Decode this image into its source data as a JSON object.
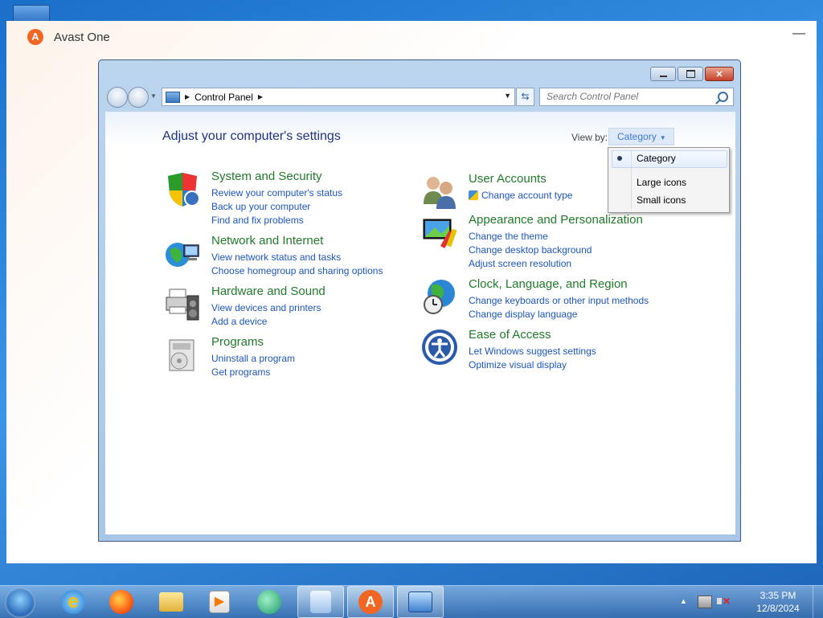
{
  "avast": {
    "title": "Avast One",
    "logo": "avast-logo-icon",
    "minimize": "—"
  },
  "window": {
    "address": {
      "crumb": "Control Panel"
    },
    "search": {
      "placeholder": "Search Control Panel"
    },
    "heading": "Adjust your computer's settings",
    "view_by": {
      "label": "View by:",
      "value": "Category"
    },
    "categories": [
      {
        "title": "System and Security",
        "icon": "shield-icon",
        "links": [
          "Review your computer's status",
          "Back up your computer",
          "Find and fix problems"
        ]
      },
      {
        "title": "Network and Internet",
        "icon": "network-globe-icon",
        "links": [
          "View network status and tasks",
          "Choose homegroup and sharing options"
        ]
      },
      {
        "title": "Hardware and Sound",
        "icon": "printer-speaker-icon",
        "links": [
          "View devices and printers",
          "Add a device"
        ]
      },
      {
        "title": "Programs",
        "icon": "programs-icon",
        "links": [
          "Uninstall a program",
          "Get programs"
        ]
      },
      {
        "title": "User Accounts",
        "icon": "users-icon",
        "links": [
          "Change account type"
        ]
      },
      {
        "title": "Appearance and Personalization",
        "icon": "monitor-paint-icon",
        "links": [
          "Change the theme",
          "Change desktop background",
          "Adjust screen resolution"
        ]
      },
      {
        "title": "Clock, Language, and Region",
        "icon": "globe-clock-icon",
        "links": [
          "Change keyboards or other input methods",
          "Change display language"
        ]
      },
      {
        "title": "Ease of Access",
        "icon": "ease-of-access-icon",
        "links": [
          "Let Windows suggest settings",
          "Optimize visual display"
        ]
      }
    ]
  },
  "view_menu": {
    "items": [
      "Category",
      "Large icons",
      "Small icons"
    ],
    "selected": "Category"
  },
  "taskbar": {
    "apps": [
      "internet-explorer-icon",
      "firefox-icon",
      "file-explorer-icon",
      "media-player-icon",
      "chat-app-icon",
      "recycle-app-icon",
      "avast-icon",
      "control-panel-icon"
    ],
    "active": [
      "recycle-app-icon",
      "avast-icon",
      "control-panel-icon"
    ],
    "clock": {
      "time": "3:35 PM",
      "date": "12/8/2024"
    }
  },
  "colors": {
    "category_title": "#207a2a",
    "link": "#1c56bd",
    "heading": "#1e3287",
    "avast_orange": "#f26522"
  }
}
